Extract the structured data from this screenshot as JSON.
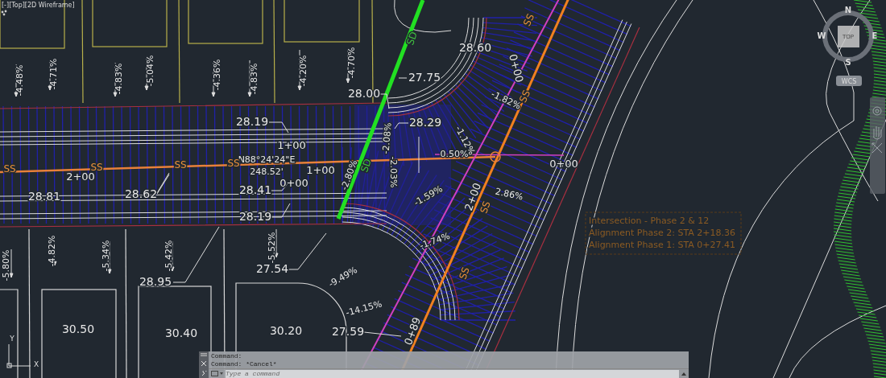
{
  "viewport": {
    "label": "[-][Top][2D Wireframe]"
  },
  "slope_labels": [
    "-4.48%",
    "-4.71%",
    "-4.83%",
    "-5.04%",
    "-4.36%",
    "-4.83%",
    "-4.20%",
    "-4.70%",
    "-5.80%",
    "-4.82%",
    "-5.34%",
    "-5.42%",
    "-5.52%",
    "-2.08%",
    "-2.80%",
    "-2.03%",
    "-1.59%",
    "-1.74%",
    "-9.49%",
    "-14.15%",
    "-1.82%",
    "-1.12%",
    "0.50%",
    "2.86%"
  ],
  "elevation_labels": [
    "28.60",
    "27.75",
    "28.00",
    "28.19",
    "28.29",
    "28.81",
    "28.62",
    "28.41",
    "28.19",
    "28.95",
    "27.54",
    "27.59"
  ],
  "station_labels": [
    "1+00",
    "2+00",
    "1+00",
    "0+00",
    "0+00",
    "2+00",
    "0+00",
    "0+89"
  ],
  "bearing": {
    "direction": "N88°24'24\"E",
    "distance": "248.52'"
  },
  "lot_elevations": [
    "30.50",
    "30.40",
    "30.20"
  ],
  "pipe_labels": [
    "SS",
    "SS",
    "SS",
    "SS",
    "SS",
    "SS",
    "SS",
    "SS",
    "SD",
    "SD"
  ],
  "intersection_note": [
    "Intersection - Phase 2 & 12",
    "Alignment Phase 2: STA 2+18.36",
    "Alignment Phase 1: STA 0+27.41"
  ],
  "viewcube": {
    "face": "TOP",
    "north": "N",
    "east": "E",
    "south": "S",
    "west": "W",
    "coordinate_system": "WCS"
  },
  "ucs_icon": {
    "x_axis": "X",
    "y_axis": "Y"
  },
  "command_line": {
    "history": [
      "Command:",
      "Command: *Cancel*"
    ],
    "placeholder": "Type a command"
  }
}
